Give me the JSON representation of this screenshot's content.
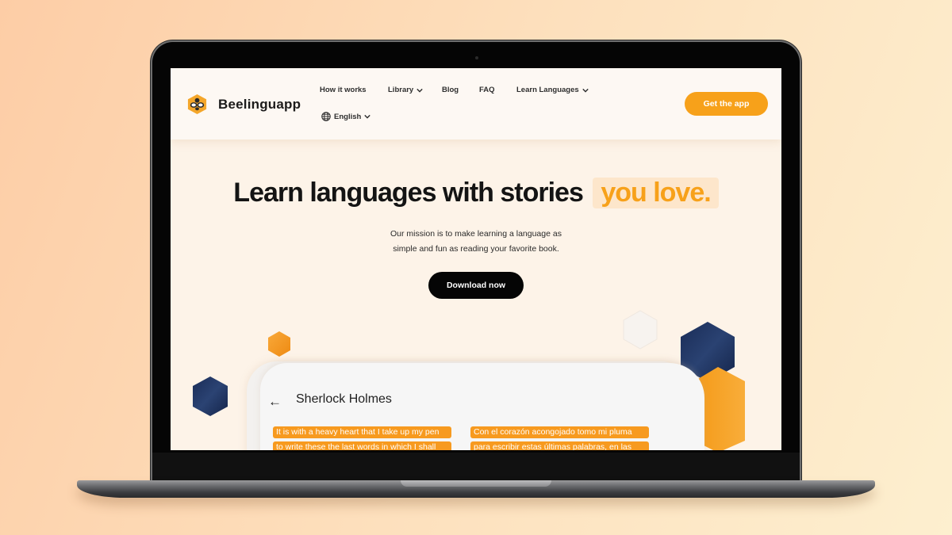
{
  "header": {
    "brand": "Beelinguapp",
    "nav": [
      {
        "label": "How it works",
        "has_dropdown": false
      },
      {
        "label": "Library",
        "has_dropdown": true
      },
      {
        "label": "Blog",
        "has_dropdown": false
      },
      {
        "label": "FAQ",
        "has_dropdown": false
      },
      {
        "label": "Learn Languages",
        "has_dropdown": true
      }
    ],
    "language": {
      "label": "English",
      "icon": "globe-icon"
    },
    "cta_label": "Get the app"
  },
  "hero": {
    "title": "Learn languages with stories",
    "highlight": "you love.",
    "subtitle_line1": "Our mission is to make learning a language as",
    "subtitle_line2": "simple and fun as reading your favorite book.",
    "button_label": "Download now"
  },
  "reader": {
    "back_icon": "arrow-left-icon",
    "title": "Sherlock Holmes",
    "left_lines": [
      "It is with a heavy heart that I take up my pen",
      "to write these the last words in which I shall"
    ],
    "right_lines": [
      "Con el corazón acongojado tomo mi pluma",
      "para escribir estas últimas palabras, en las"
    ]
  },
  "colors": {
    "accent": "#f7a11a",
    "navy": "#1c2f5a",
    "dark": "#050505",
    "highlight_bg": "#fde6cb"
  }
}
